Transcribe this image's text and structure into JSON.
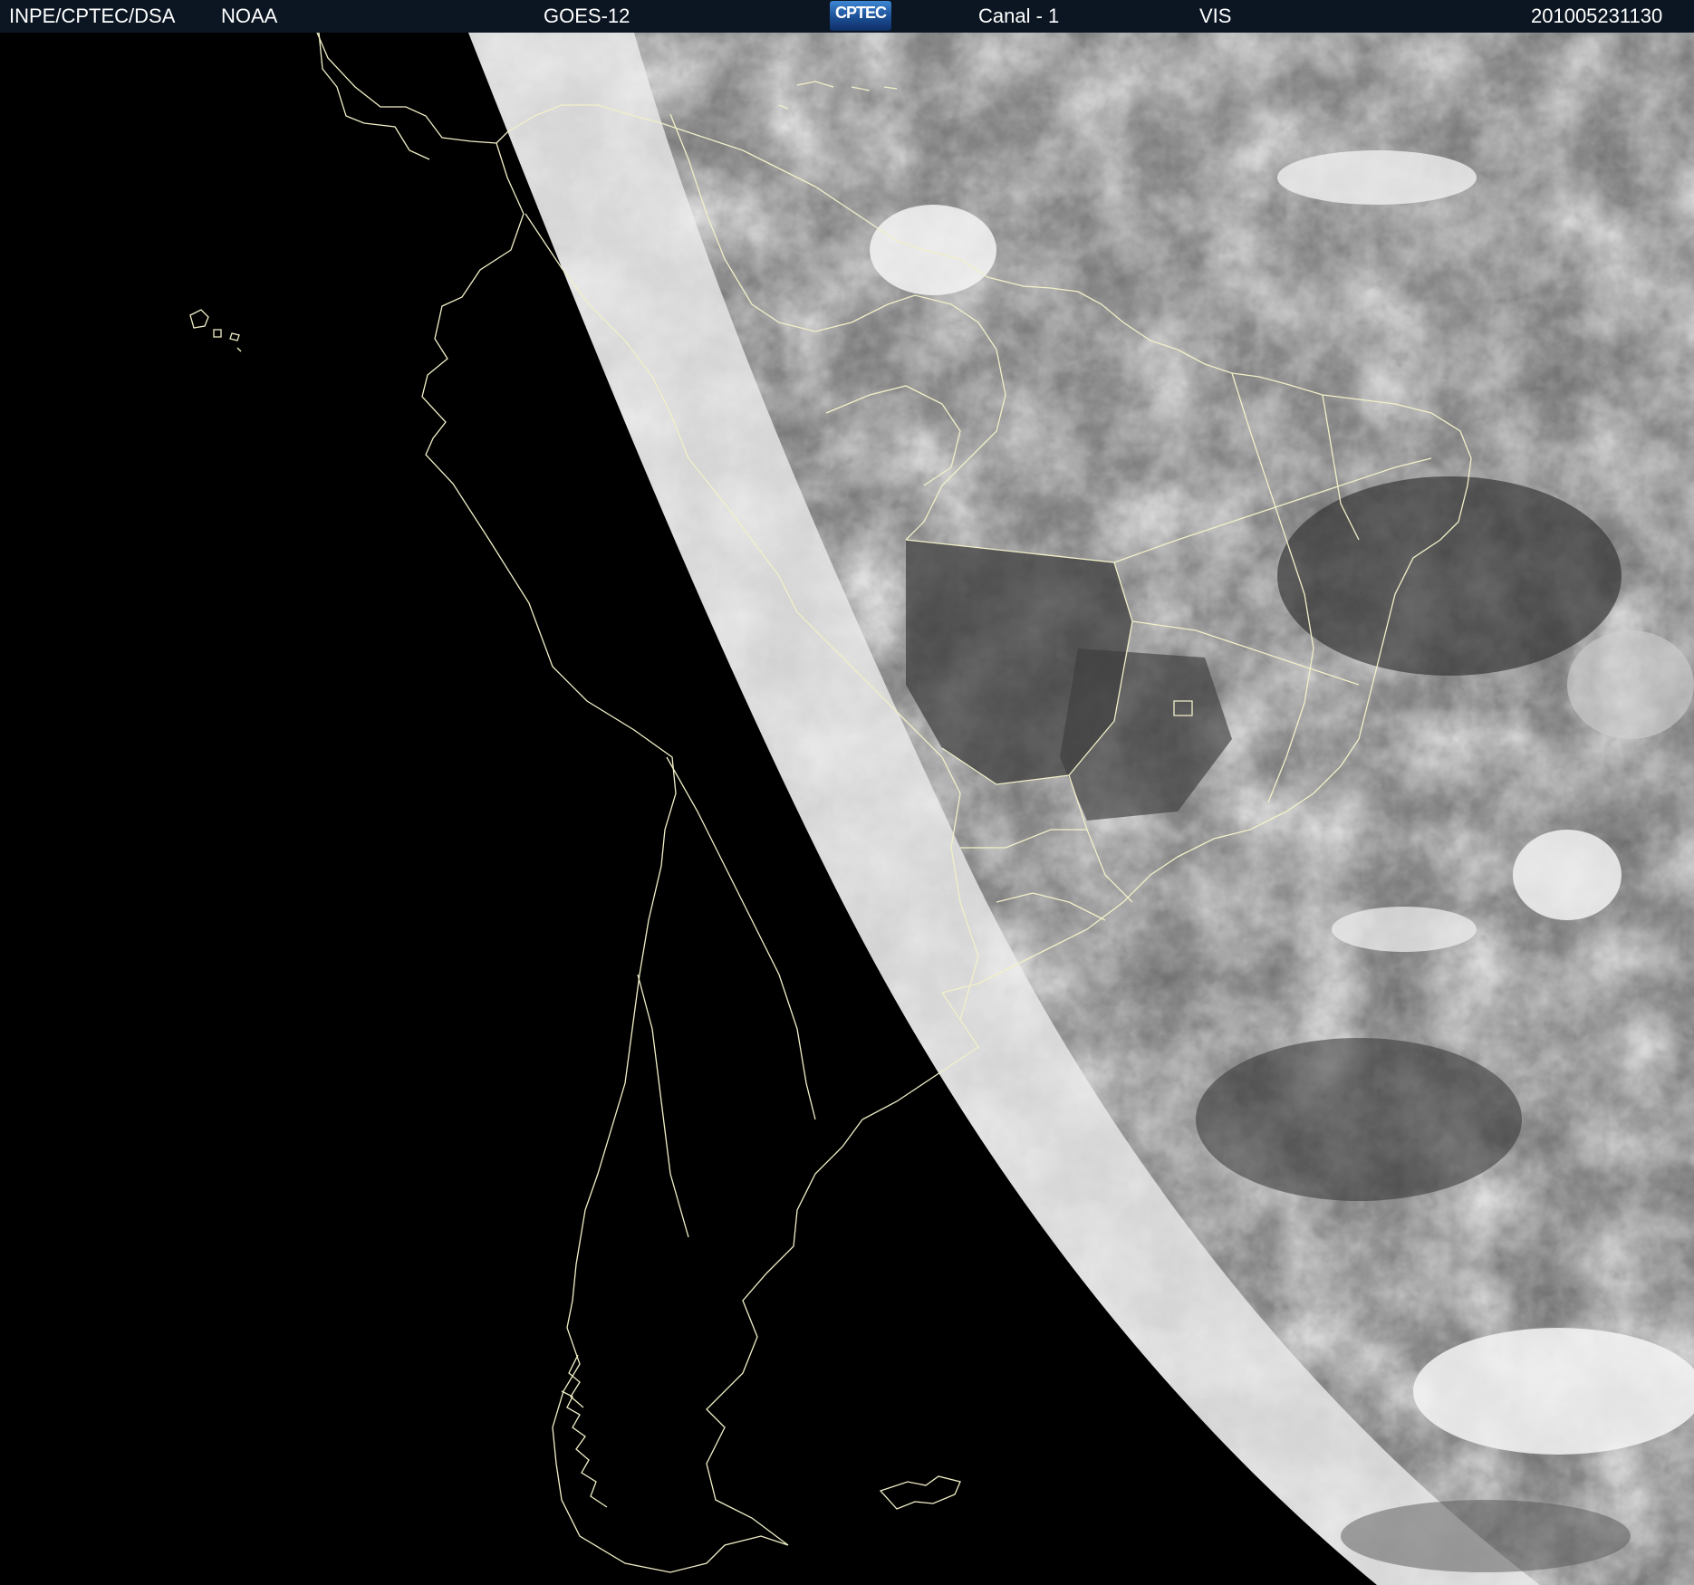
{
  "header": {
    "source": "INPE/CPTEC/DSA",
    "agency": "NOAA",
    "satellite": "GOES-12",
    "logo_text": "CPTEC",
    "channel": "Canal - 1",
    "band": "VIS",
    "timestamp": "201005231130"
  },
  "colors": {
    "header_bg": "#0b1622",
    "header_text": "#ffffff",
    "space": "#000000",
    "coastline": "#f2f0c8",
    "ocean_gray": "#3c3c3c",
    "cloud_white": "#f2f2f2"
  }
}
